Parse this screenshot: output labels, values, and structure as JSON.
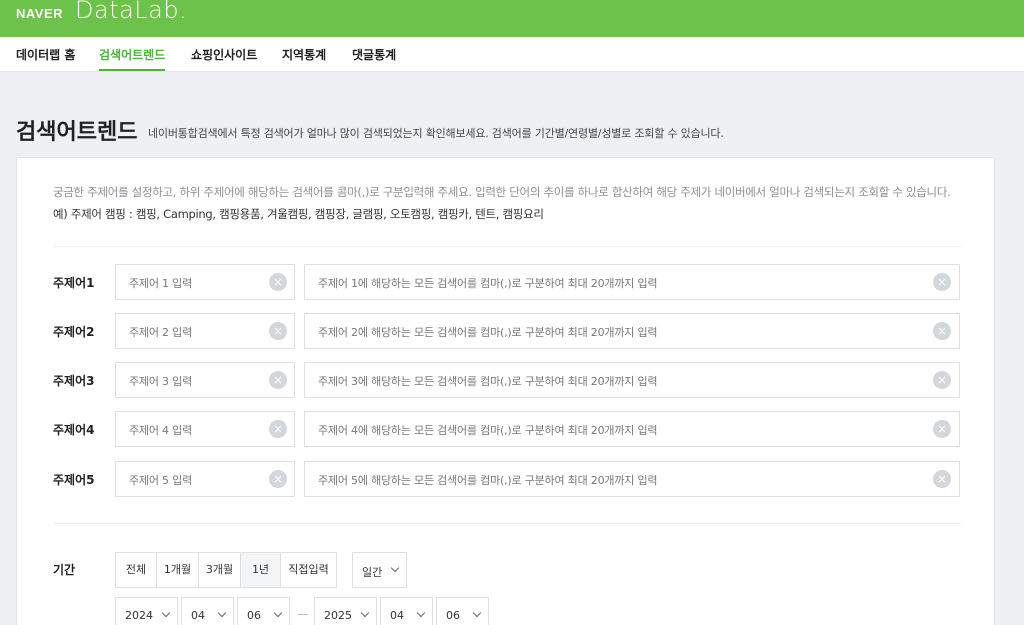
{
  "header": {
    "brand": "NAVER",
    "product": "DataLab."
  },
  "nav": {
    "items": [
      {
        "label": "데이터랩 홈"
      },
      {
        "label": "검색어트렌드"
      },
      {
        "label": "쇼핑인사이트"
      },
      {
        "label": "지역통계"
      },
      {
        "label": "댓글통계"
      }
    ],
    "active": "검색어트렌드"
  },
  "page": {
    "title": "검색어트렌드",
    "description": "네이버통합검색에서 특정 검색어가 얼마나 많이 검색되었는지 확인해보세요. 검색어를 기간별/연령별/성별로 조회할 수 있습니다."
  },
  "guide": {
    "text": "궁금한 주제어를 설정하고, 하위 주제어에 해당하는 검색어를 콤마(,)로 구분입력해 주세요. 입력한 단어의 추이를 하나로 합산하여 해당 주제가 네이버에서 얼마나 검색되는지 조회할 수 있습니다. ",
    "example": "예) 주제어 캠핑 : 캠핑, Camping, 캠핑용품, 겨울캠핑, 캠핑장, 글램핑, 오토캠핑, 캠핑카, 텐트, 캠핑요리"
  },
  "topics": [
    {
      "label": "주제어1",
      "name_placeholder": "주제어 1 입력",
      "keywords_placeholder": "주제어 1에 해당하는 모든 검색어를 컴마(,)로 구분하여 최대 20개까지 입력"
    },
    {
      "label": "주제어2",
      "name_placeholder": "주제어 2 입력",
      "keywords_placeholder": "주제어 2에 해당하는 모든 검색어를 컴마(,)로 구분하여 최대 20개까지 입력"
    },
    {
      "label": "주제어3",
      "name_placeholder": "주제어 3 입력",
      "keywords_placeholder": "주제어 3에 해당하는 모든 검색어를 컴마(,)로 구분하여 최대 20개까지 입력"
    },
    {
      "label": "주제어4",
      "name_placeholder": "주제어 4 입력",
      "keywords_placeholder": "주제어 4에 해당하는 모든 검색어를 컴마(,)로 구분하여 최대 20개까지 입력"
    },
    {
      "label": "주제어5",
      "name_placeholder": "주제어 5 입력",
      "keywords_placeholder": "주제어 5에 해당하는 모든 검색어를 컴마(,)로 구분하여 최대 20개까지 입력"
    }
  ],
  "period": {
    "label": "기간",
    "options": [
      "전체",
      "1개월",
      "3개월",
      "1년",
      "직접입력"
    ],
    "selected": "1년",
    "interval": "일간",
    "start": {
      "year": "2024",
      "month": "04",
      "day": "06"
    },
    "end": {
      "year": "2025",
      "month": "04",
      "day": "06"
    }
  },
  "colors": {
    "brand_green": "#6cc24a",
    "active_green": "#4fb33a"
  },
  "icons": {
    "clear": "clear-icon",
    "dropdown": "chevron-down-icon"
  }
}
